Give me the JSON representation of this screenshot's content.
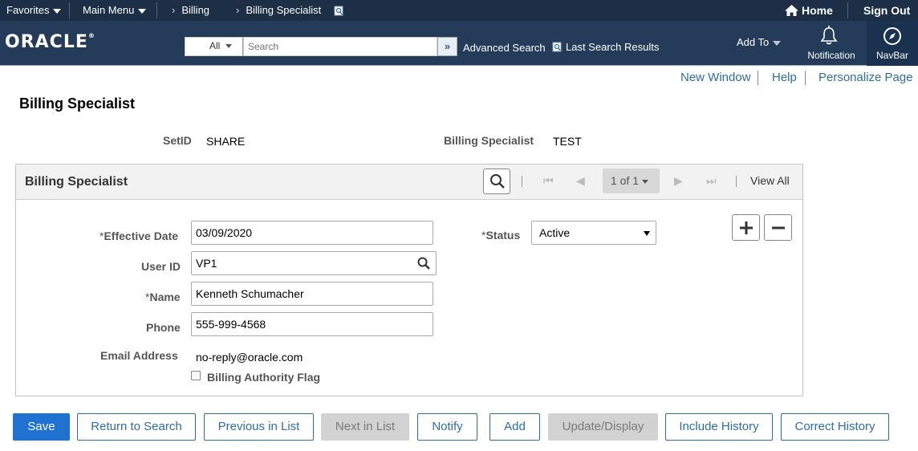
{
  "topnav": {
    "favorites": "Favorites",
    "main_menu": "Main Menu",
    "crumb1": "Billing",
    "crumb2": "Billing Specialist",
    "home": "Home",
    "sign_out": "Sign Out"
  },
  "header": {
    "logo": "ORACLE",
    "logo_mark": "®",
    "search_category": "All",
    "search_placeholder": "Search",
    "advanced_search": "Advanced Search",
    "last_search_results": "Last Search Results",
    "add_to": "Add To",
    "notification": "Notification",
    "navbar": "NavBar",
    "go_glyph": "»"
  },
  "page_links": {
    "new_window": "New Window",
    "help": "Help",
    "personalize": "Personalize Page"
  },
  "page": {
    "title": "Billing Specialist",
    "setid_label": "SetID",
    "setid_value": "SHARE",
    "specialist_label": "Billing Specialist",
    "specialist_value": "TEST"
  },
  "group": {
    "title": "Billing Specialist",
    "pager": "1 of 1",
    "view_all": "View All",
    "nav_first": "⏮",
    "nav_prev": "◀",
    "nav_next": "▶",
    "nav_last": "⏭"
  },
  "form": {
    "req_mark": "*",
    "effective_date_label": "Effective Date",
    "effective_date": "03/09/2020",
    "status_label": "Status",
    "status": "Active",
    "user_id_label": "User ID",
    "user_id": "VP1",
    "name_label": "Name",
    "name": "Kenneth Schumacher",
    "phone_label": "Phone",
    "phone": "555-999-4568",
    "email_label": "Email Address",
    "email": "no-reply@oracle.com",
    "billing_authority_label": "Billing Authority Flag"
  },
  "buttons": {
    "save": "Save",
    "return_to_search": "Return to Search",
    "previous_in_list": "Previous in List",
    "next_in_list": "Next in List",
    "notify": "Notify",
    "add": "Add",
    "update_display": "Update/Display",
    "include_history": "Include History",
    "correct_history": "Correct History"
  },
  "colors": {
    "topbar": "#1c2f46",
    "header": "#243c5a",
    "link": "#2e6da4",
    "primary": "#1f72d1"
  }
}
